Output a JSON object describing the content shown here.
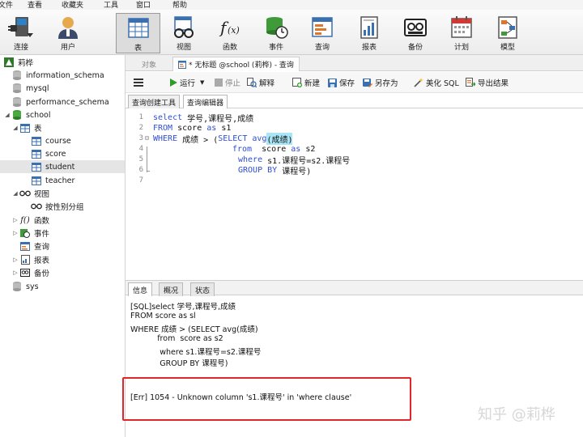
{
  "menubar": {
    "items": [
      "文件",
      "查看",
      "收藏夹",
      "工具",
      "窗口",
      "帮助"
    ]
  },
  "toolbar": {
    "buttons": [
      {
        "label": "连接",
        "icon": "plug-icon"
      },
      {
        "label": "用户",
        "icon": "user-icon"
      },
      {
        "label": "表",
        "icon": "table-icon",
        "active": true
      },
      {
        "label": "视图",
        "icon": "view-glasses-icon"
      },
      {
        "label": "函数",
        "icon": "function-icon"
      },
      {
        "label": "事件",
        "icon": "event-icon"
      },
      {
        "label": "查询",
        "icon": "query-icon"
      },
      {
        "label": "报表",
        "icon": "report-icon"
      },
      {
        "label": "备份",
        "icon": "backup-icon"
      },
      {
        "label": "计划",
        "icon": "calendar-icon"
      },
      {
        "label": "模型",
        "icon": "model-icon"
      }
    ]
  },
  "sidebar": {
    "connection": "莉桦",
    "databases": [
      "information_schema",
      "mysql",
      "performance_schema",
      "school"
    ],
    "school_children": {
      "tables_label": "表",
      "tables": [
        "course",
        "score",
        "student",
        "teacher"
      ],
      "selected_table": "student",
      "views_label": "视图",
      "views": [
        "按性别分组"
      ],
      "functions_label": "函数",
      "events_label": "事件",
      "queries_label": "查询",
      "reports_label": "报表",
      "backups_label": "备份"
    },
    "sys": "sys"
  },
  "doc_tabs": {
    "objects": "对象",
    "query_tab": "* 无标题 @school (莉桦) - 查询"
  },
  "query_toolbar": {
    "run": "运行",
    "stop": "停止",
    "explain": "解释",
    "new": "新建",
    "save": "保存",
    "save_as": "另存为",
    "beautify": "美化 SQL",
    "export": "导出结果"
  },
  "subtabs": {
    "builder": "查询创建工具",
    "editor": "查询编辑器"
  },
  "editor": {
    "line_numbers": [
      "1",
      "2",
      "3",
      "4",
      "5",
      "6",
      "7"
    ],
    "l1_kw": "select",
    "l1_rest": " 学号,课程号,成绩",
    "l2_kw1": "FROM",
    "l2_mid": " score ",
    "l2_kw2": "as",
    "l2_rest": " s1",
    "l3_kw1": "WHERE",
    "l3_mid": " 成绩 > (",
    "l3_kw2": "SELECT",
    "l3_sp": " ",
    "l3_fn": "avg",
    "l3_hl": "(成绩)",
    "l4_kw1": "from",
    "l4_mid": "  score ",
    "l4_kw2": "as",
    "l4_rest": " s2",
    "l5_kw": "where",
    "l5_rest": " s1.课程号=s2.课程号",
    "l6_kw": "GROUP BY",
    "l6_rest": " 课程号)"
  },
  "bottom_tabs": {
    "info": "信息",
    "overview": "概况",
    "status": "状态"
  },
  "output": {
    "lines": [
      "[SQL]select 学号,课程号,成绩",
      "FROM score as sl",
      "WHERE 成绩 > (SELECT avg(成绩)",
      "           from  score as s2",
      "            where s1.课程号=s2.课程号",
      "            GROUP BY 课程号)"
    ],
    "error": "[Err] 1054 - Unknown column 's1.课程号' in 'where clause'"
  },
  "watermark": "知乎 @莉桦"
}
